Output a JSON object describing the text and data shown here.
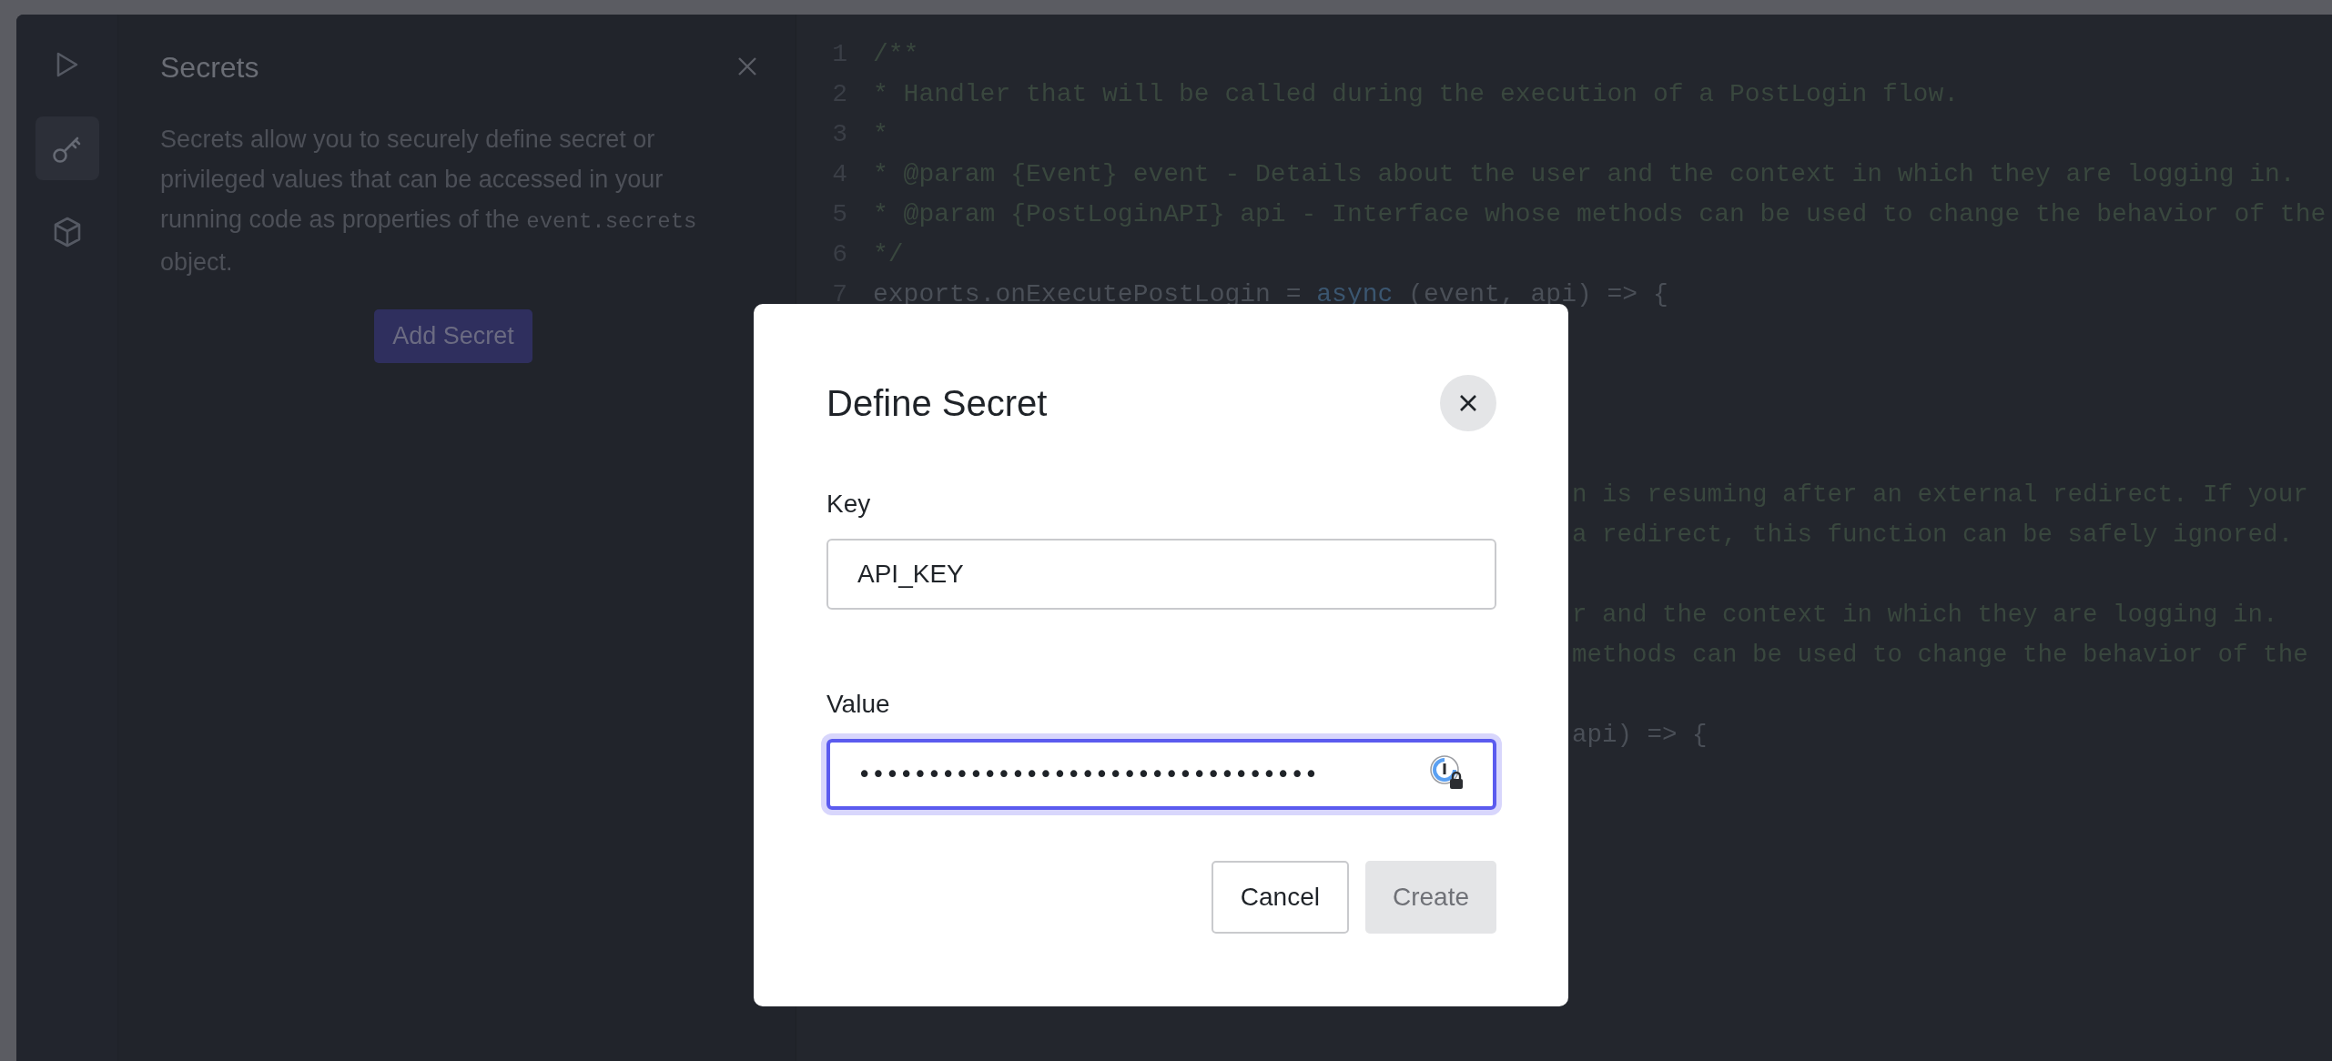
{
  "sidebar": {
    "items": [
      {
        "kind": "play",
        "selected": false
      },
      {
        "kind": "key",
        "selected": true
      },
      {
        "kind": "cube",
        "selected": false
      }
    ]
  },
  "secrets_panel": {
    "title": "Secrets",
    "description": {
      "before": "Secrets allow you to securely define secret or privileged values that can be accessed in your running code as properties of the ",
      "code": "event.secrets",
      "after": " object."
    },
    "button": "Add Secret"
  },
  "editor": {
    "lines": [
      {
        "number": "1",
        "tokens": [
          {
            "kind": "comment",
            "text": "/**"
          }
        ]
      },
      {
        "number": "2",
        "tokens": [
          {
            "kind": "comment",
            "text": "* Handler that will be called during the execution of a PostLogin flow."
          }
        ]
      },
      {
        "number": "3",
        "tokens": [
          {
            "kind": "comment",
            "text": "*"
          }
        ]
      },
      {
        "number": "4",
        "tokens": [
          {
            "kind": "comment",
            "text": "* @param {Event} event - Details about the user and the context in which they are logging in."
          }
        ]
      },
      {
        "number": "5",
        "tokens": [
          {
            "kind": "comment",
            "text": "* @param {PostLoginAPI} api - Interface whose methods can be used to change the behavior of the"
          }
        ]
      },
      {
        "number": "6",
        "tokens": [
          {
            "kind": "comment",
            "text": "*/"
          }
        ]
      },
      {
        "number": "7",
        "tokens": [
          {
            "kind": "code",
            "text": "exports.onExecutePostLogin = "
          },
          {
            "kind": "keyword",
            "text": "async"
          },
          {
            "kind": "code",
            "text": " (event, api) => {"
          }
        ]
      }
    ],
    "beside_dialog": [
      {
        "kind": "text",
        "tokens": [
          {
            "kind": "comment",
            "text": "n is resuming after an external redirect. If your"
          }
        ]
      },
      {
        "kind": "text",
        "tokens": [
          {
            "kind": "comment",
            "text": "a redirect, this function can be safely ignored."
          }
        ]
      },
      {
        "kind": "blank"
      },
      {
        "kind": "text",
        "tokens": [
          {
            "kind": "comment",
            "text": "r and the context in which they are logging in."
          }
        ]
      },
      {
        "kind": "text",
        "tokens": [
          {
            "kind": "comment",
            "text": "methods can be used to change the behavior of the"
          }
        ]
      },
      {
        "kind": "blank"
      },
      {
        "kind": "text",
        "tokens": [
          {
            "kind": "code",
            "text": "api) => {"
          }
        ]
      }
    ]
  },
  "dialog": {
    "title": "Define Secret",
    "fields": [
      {
        "label": "Key",
        "value": "API_KEY",
        "focused": false,
        "kind": "text"
      },
      {
        "label": "Value",
        "value": "•••••••••••••••••••••••••••••••••",
        "focused": true,
        "kind": "password"
      }
    ],
    "buttons": [
      {
        "label": "Cancel",
        "kind": "secondary",
        "disabled": false
      },
      {
        "label": "Create",
        "kind": "primary",
        "disabled": true
      }
    ]
  }
}
